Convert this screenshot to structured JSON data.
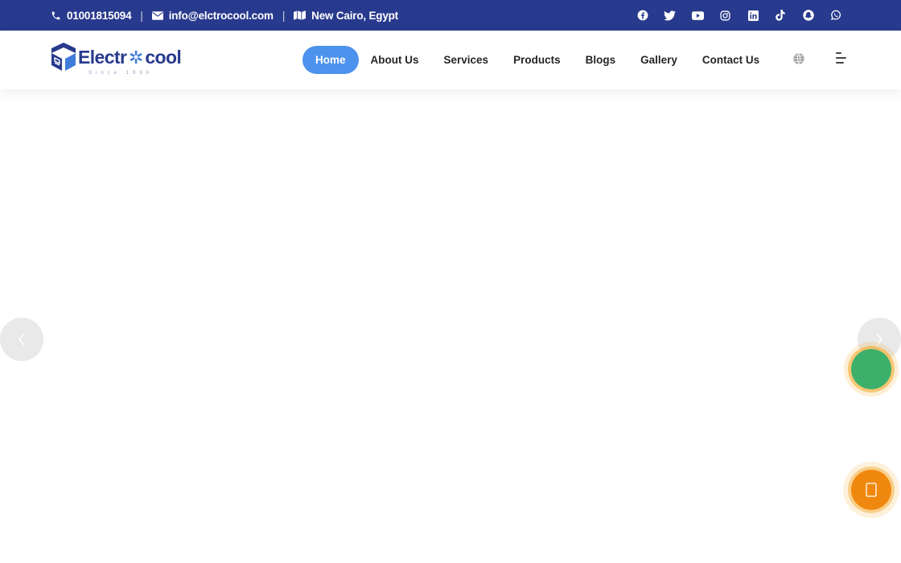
{
  "topbar": {
    "phone": "01001815094",
    "email": "info@elctrocool.com",
    "location": "New Cairo, Egypt",
    "separator": "|",
    "socials": [
      "facebook-icon",
      "twitter-icon",
      "youtube-icon",
      "instagram-icon",
      "linkedin-icon",
      "tiktok-icon",
      "snapchat-icon",
      "whatsapp-icon"
    ]
  },
  "brand": {
    "name_part1": "Electr",
    "name_part2": "cool",
    "tagline": "Since 1990"
  },
  "nav": {
    "items": [
      {
        "label": "Home",
        "active": true
      },
      {
        "label": "About Us"
      },
      {
        "label": "Services"
      },
      {
        "label": "Products"
      },
      {
        "label": "Blogs"
      },
      {
        "label": "Gallery"
      },
      {
        "label": "Contact Us"
      }
    ]
  },
  "icons": {
    "language": "globe-icon",
    "menu": "menu-icon",
    "prev": "chevron-left-icon",
    "next": "chevron-right-icon",
    "call": "phone-icon"
  },
  "colors": {
    "topbar": "#283a8d",
    "accent": "#4d92ec",
    "whatsapp": "#3cb06a",
    "call": "#f0880f"
  }
}
